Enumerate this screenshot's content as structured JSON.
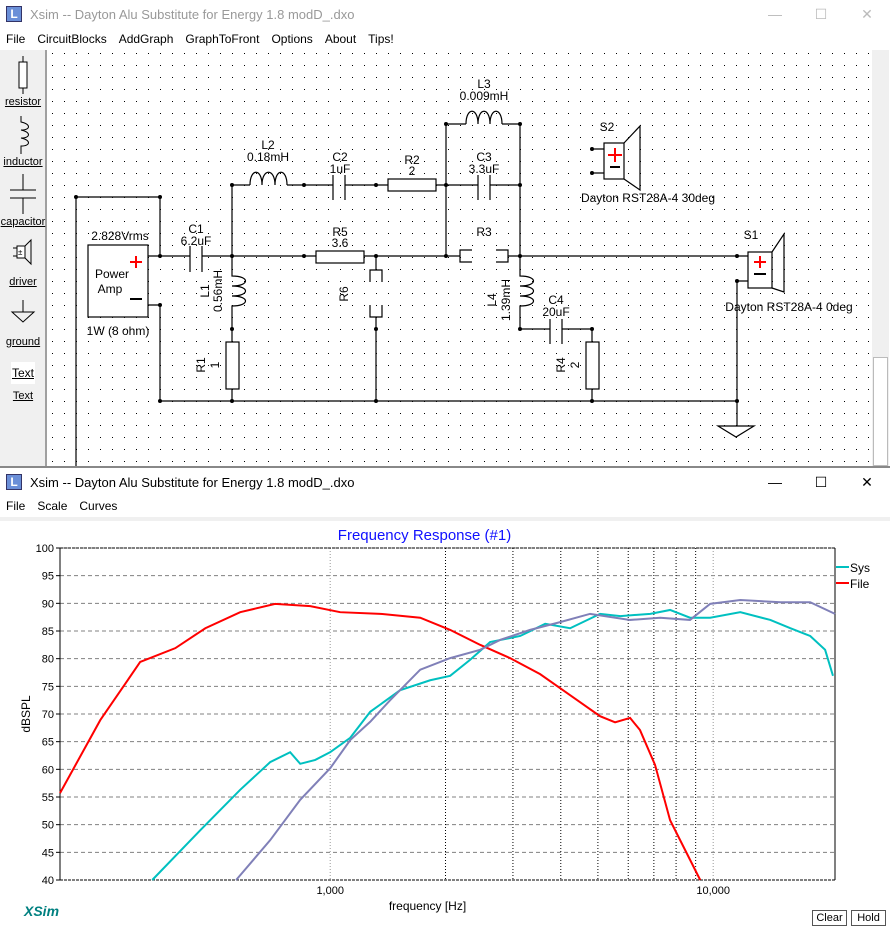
{
  "top_window": {
    "title": "Xsim -- Dayton Alu Substitute for Energy 1.8 modD_.dxo",
    "menu": [
      "File",
      "CircuitBlocks",
      "AddGraph",
      "GraphToFront",
      "Options",
      "About",
      "Tips!"
    ],
    "toolbox": [
      {
        "label": "resistor",
        "icon": "resistor-icon"
      },
      {
        "label": "inductor",
        "icon": "inductor-icon"
      },
      {
        "label": "capacitor",
        "icon": "capacitor-icon"
      },
      {
        "label": "driver",
        "icon": "driver-icon"
      },
      {
        "label": "ground",
        "icon": "ground-icon"
      },
      {
        "label": "Text",
        "icon": "text-icon",
        "icon_text": "Text"
      }
    ],
    "circuit": {
      "amp": {
        "voltage": "2.828Vrms",
        "name1": "Power",
        "name2": "Amp",
        "power": "1W (8 ohm)"
      },
      "C1": {
        "name": "C1",
        "value": "6.2uF"
      },
      "L1": {
        "name": "L1",
        "value": "0.56mH"
      },
      "R1": {
        "name": "R1",
        "value": "1"
      },
      "L2": {
        "name": "L2",
        "value": "0.18mH"
      },
      "C2": {
        "name": "C2",
        "value": "1uF"
      },
      "R2": {
        "name": "R2",
        "value": "2"
      },
      "R5": {
        "name": "R5",
        "value": "3.6"
      },
      "R6": {
        "name": "R6"
      },
      "L3": {
        "name": "L3",
        "value": "0.009mH"
      },
      "C3": {
        "name": "C3",
        "value": "3.3uF"
      },
      "R3": {
        "name": "R3"
      },
      "L4": {
        "name": "L4",
        "value": "1.39mH"
      },
      "C4": {
        "name": "C4",
        "value": "20uF"
      },
      "R4": {
        "name": "R4",
        "value": "2"
      },
      "S1": {
        "name": "S1",
        "label": "Dayton RST28A-4  0deg"
      },
      "S2": {
        "name": "S2",
        "label": "Dayton RST28A-4  30deg"
      }
    }
  },
  "graph_window": {
    "title": "Xsim -- Dayton Alu Substitute for Energy 1.8 modD_.dxo",
    "menu": [
      "File",
      "Scale",
      "Curves"
    ],
    "logo": "XSim",
    "clear_label": "Clear",
    "hold_label": "Hold"
  },
  "chart_data": {
    "type": "line",
    "title": "Frequency Response (#1)",
    "xlabel": "frequency [Hz]",
    "ylabel": "dBSPL",
    "xscale": "log",
    "xlim": [
      197,
      20800
    ],
    "ylim": [
      40,
      100
    ],
    "yticks": [
      40,
      45,
      50,
      55,
      60,
      65,
      70,
      75,
      80,
      85,
      90,
      95,
      100
    ],
    "xtick_labels": [
      {
        "value": 1000,
        "label": "1,000"
      },
      {
        "value": 10000,
        "label": "10,000"
      }
    ],
    "grid": true,
    "legend_placement": "right-top",
    "series": [
      {
        "name": "Sys",
        "color": "#00c0c0",
        "points": [
          [
            343,
            40
          ],
          [
            458,
            49
          ],
          [
            582,
            56.3
          ],
          [
            697,
            61.3
          ],
          [
            786,
            63.1
          ],
          [
            835,
            61
          ],
          [
            914,
            61.7
          ],
          [
            1000,
            63.1
          ],
          [
            1128,
            65.7
          ],
          [
            1272,
            70.4
          ],
          [
            1523,
            74.3
          ],
          [
            1824,
            76.1
          ],
          [
            2057,
            76.9
          ],
          [
            2320,
            79.8
          ],
          [
            2615,
            83
          ],
          [
            3133,
            84.1
          ],
          [
            3642,
            86.3
          ],
          [
            4231,
            85.5
          ],
          [
            5066,
            88.1
          ],
          [
            5724,
            87.7
          ],
          [
            6851,
            88.1
          ],
          [
            7718,
            88.8
          ],
          [
            8700,
            87.4
          ],
          [
            9820,
            87.4
          ],
          [
            11770,
            88.4
          ],
          [
            14100,
            87
          ],
          [
            15900,
            85.5
          ],
          [
            17920,
            84.1
          ],
          [
            19600,
            81.6
          ],
          [
            20550,
            76.9
          ]
        ]
      },
      {
        "name": "File",
        "color": "#ff0000",
        "points": [
          [
            197,
            55.7
          ],
          [
            251,
            68.9
          ],
          [
            319,
            79.4
          ],
          [
            394,
            81.9
          ],
          [
            472,
            85.5
          ],
          [
            582,
            88.4
          ],
          [
            718,
            89.9
          ],
          [
            887,
            89.5
          ],
          [
            1062,
            88.4
          ],
          [
            1351,
            88.1
          ],
          [
            1718,
            87.4
          ],
          [
            2057,
            85.2
          ],
          [
            2463,
            82.5
          ],
          [
            2950,
            80.1
          ],
          [
            3533,
            77.2
          ],
          [
            4231,
            73.4
          ],
          [
            5066,
            69.6
          ],
          [
            5544,
            68.5
          ],
          [
            6067,
            69.3
          ],
          [
            6440,
            67.1
          ],
          [
            7050,
            60.8
          ],
          [
            7718,
            50.8
          ],
          [
            8450,
            45.4
          ],
          [
            9250,
            40
          ]
        ]
      },
      {
        "color": "#8080b8",
        "points": [
          [
            568,
            40
          ],
          [
            697,
            47.2
          ],
          [
            835,
            54.5
          ],
          [
            1000,
            60.2
          ],
          [
            1128,
            65.3
          ],
          [
            1272,
            68.6
          ],
          [
            1434,
            72.5
          ],
          [
            1718,
            78
          ],
          [
            2057,
            80.1
          ],
          [
            2463,
            81.6
          ],
          [
            2781,
            83.4
          ],
          [
            3327,
            85.2
          ],
          [
            3984,
            86.6
          ],
          [
            4771,
            88.1
          ],
          [
            6067,
            87
          ],
          [
            7270,
            87.4
          ],
          [
            8700,
            87
          ],
          [
            9820,
            89.9
          ],
          [
            11770,
            90.6
          ],
          [
            15000,
            90.2
          ],
          [
            17920,
            90.2
          ],
          [
            20800,
            88.1
          ]
        ]
      }
    ]
  }
}
